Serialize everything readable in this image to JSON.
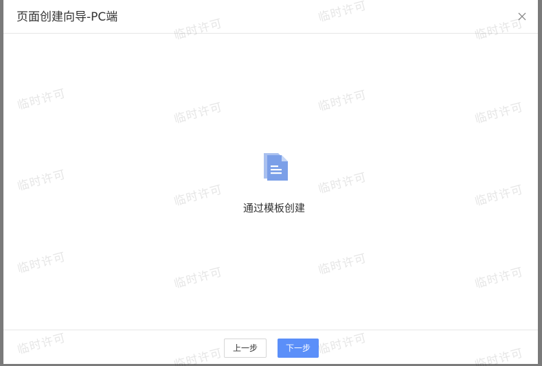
{
  "dialog": {
    "title": "页面创建向导-PC端",
    "close_icon": "close-icon"
  },
  "body": {
    "option": {
      "icon": "document-icon",
      "label": "通过模板创建"
    }
  },
  "footer": {
    "prev_label": "上一步",
    "next_label": "下一步"
  },
  "watermark": {
    "text": "临时许可"
  },
  "colors": {
    "primary": "#5b8ff9",
    "icon_light": "#a9c0ef",
    "icon_dark": "#6f95e6"
  }
}
